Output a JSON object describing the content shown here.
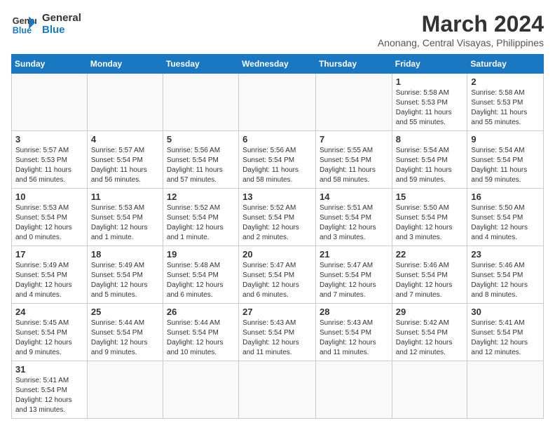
{
  "header": {
    "logo_general": "General",
    "logo_blue": "Blue",
    "month_year": "March 2024",
    "location": "Anonang, Central Visayas, Philippines"
  },
  "weekdays": [
    "Sunday",
    "Monday",
    "Tuesday",
    "Wednesday",
    "Thursday",
    "Friday",
    "Saturday"
  ],
  "weeks": [
    [
      {
        "day": "",
        "info": ""
      },
      {
        "day": "",
        "info": ""
      },
      {
        "day": "",
        "info": ""
      },
      {
        "day": "",
        "info": ""
      },
      {
        "day": "",
        "info": ""
      },
      {
        "day": "1",
        "info": "Sunrise: 5:58 AM\nSunset: 5:53 PM\nDaylight: 11 hours\nand 55 minutes."
      },
      {
        "day": "2",
        "info": "Sunrise: 5:58 AM\nSunset: 5:53 PM\nDaylight: 11 hours\nand 55 minutes."
      }
    ],
    [
      {
        "day": "3",
        "info": "Sunrise: 5:57 AM\nSunset: 5:53 PM\nDaylight: 11 hours\nand 56 minutes."
      },
      {
        "day": "4",
        "info": "Sunrise: 5:57 AM\nSunset: 5:54 PM\nDaylight: 11 hours\nand 56 minutes."
      },
      {
        "day": "5",
        "info": "Sunrise: 5:56 AM\nSunset: 5:54 PM\nDaylight: 11 hours\nand 57 minutes."
      },
      {
        "day": "6",
        "info": "Sunrise: 5:56 AM\nSunset: 5:54 PM\nDaylight: 11 hours\nand 58 minutes."
      },
      {
        "day": "7",
        "info": "Sunrise: 5:55 AM\nSunset: 5:54 PM\nDaylight: 11 hours\nand 58 minutes."
      },
      {
        "day": "8",
        "info": "Sunrise: 5:54 AM\nSunset: 5:54 PM\nDaylight: 11 hours\nand 59 minutes."
      },
      {
        "day": "9",
        "info": "Sunrise: 5:54 AM\nSunset: 5:54 PM\nDaylight: 11 hours\nand 59 minutes."
      }
    ],
    [
      {
        "day": "10",
        "info": "Sunrise: 5:53 AM\nSunset: 5:54 PM\nDaylight: 12 hours\nand 0 minutes."
      },
      {
        "day": "11",
        "info": "Sunrise: 5:53 AM\nSunset: 5:54 PM\nDaylight: 12 hours\nand 1 minute."
      },
      {
        "day": "12",
        "info": "Sunrise: 5:52 AM\nSunset: 5:54 PM\nDaylight: 12 hours\nand 1 minute."
      },
      {
        "day": "13",
        "info": "Sunrise: 5:52 AM\nSunset: 5:54 PM\nDaylight: 12 hours\nand 2 minutes."
      },
      {
        "day": "14",
        "info": "Sunrise: 5:51 AM\nSunset: 5:54 PM\nDaylight: 12 hours\nand 3 minutes."
      },
      {
        "day": "15",
        "info": "Sunrise: 5:50 AM\nSunset: 5:54 PM\nDaylight: 12 hours\nand 3 minutes."
      },
      {
        "day": "16",
        "info": "Sunrise: 5:50 AM\nSunset: 5:54 PM\nDaylight: 12 hours\nand 4 minutes."
      }
    ],
    [
      {
        "day": "17",
        "info": "Sunrise: 5:49 AM\nSunset: 5:54 PM\nDaylight: 12 hours\nand 4 minutes."
      },
      {
        "day": "18",
        "info": "Sunrise: 5:49 AM\nSunset: 5:54 PM\nDaylight: 12 hours\nand 5 minutes."
      },
      {
        "day": "19",
        "info": "Sunrise: 5:48 AM\nSunset: 5:54 PM\nDaylight: 12 hours\nand 6 minutes."
      },
      {
        "day": "20",
        "info": "Sunrise: 5:47 AM\nSunset: 5:54 PM\nDaylight: 12 hours\nand 6 minutes."
      },
      {
        "day": "21",
        "info": "Sunrise: 5:47 AM\nSunset: 5:54 PM\nDaylight: 12 hours\nand 7 minutes."
      },
      {
        "day": "22",
        "info": "Sunrise: 5:46 AM\nSunset: 5:54 PM\nDaylight: 12 hours\nand 7 minutes."
      },
      {
        "day": "23",
        "info": "Sunrise: 5:46 AM\nSunset: 5:54 PM\nDaylight: 12 hours\nand 8 minutes."
      }
    ],
    [
      {
        "day": "24",
        "info": "Sunrise: 5:45 AM\nSunset: 5:54 PM\nDaylight: 12 hours\nand 9 minutes."
      },
      {
        "day": "25",
        "info": "Sunrise: 5:44 AM\nSunset: 5:54 PM\nDaylight: 12 hours\nand 9 minutes."
      },
      {
        "day": "26",
        "info": "Sunrise: 5:44 AM\nSunset: 5:54 PM\nDaylight: 12 hours\nand 10 minutes."
      },
      {
        "day": "27",
        "info": "Sunrise: 5:43 AM\nSunset: 5:54 PM\nDaylight: 12 hours\nand 11 minutes."
      },
      {
        "day": "28",
        "info": "Sunrise: 5:43 AM\nSunset: 5:54 PM\nDaylight: 12 hours\nand 11 minutes."
      },
      {
        "day": "29",
        "info": "Sunrise: 5:42 AM\nSunset: 5:54 PM\nDaylight: 12 hours\nand 12 minutes."
      },
      {
        "day": "30",
        "info": "Sunrise: 5:41 AM\nSunset: 5:54 PM\nDaylight: 12 hours\nand 12 minutes."
      }
    ],
    [
      {
        "day": "31",
        "info": "Sunrise: 5:41 AM\nSunset: 5:54 PM\nDaylight: 12 hours\nand 13 minutes."
      },
      {
        "day": "",
        "info": ""
      },
      {
        "day": "",
        "info": ""
      },
      {
        "day": "",
        "info": ""
      },
      {
        "day": "",
        "info": ""
      },
      {
        "day": "",
        "info": ""
      },
      {
        "day": "",
        "info": ""
      }
    ]
  ]
}
